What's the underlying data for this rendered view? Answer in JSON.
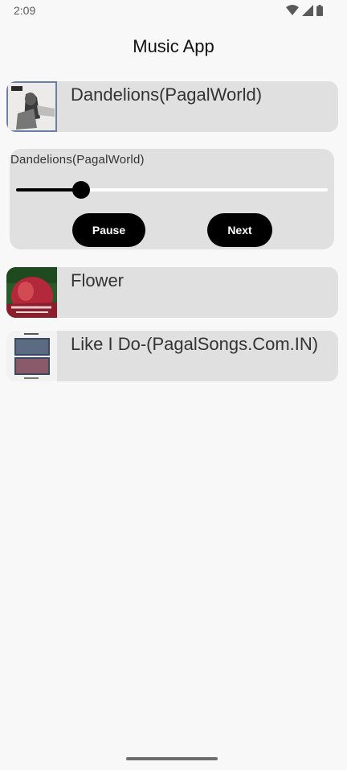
{
  "status_bar": {
    "time": "2:09",
    "icons": [
      "wifi-icon",
      "cell-signal-icon",
      "battery-icon"
    ]
  },
  "app": {
    "title": "Music App"
  },
  "songs": [
    {
      "title": "Dandelions(PagalWorld)",
      "thumbnail": "album-art-dandelions"
    },
    {
      "title": "Flower",
      "thumbnail": "album-art-flower"
    },
    {
      "title": "Like I Do-(PagalSongs.Com.IN)",
      "thumbnail": "album-art-like-i-do"
    }
  ],
  "player": {
    "now_playing": "Dandelions(PagalWorld)",
    "progress": 0.21,
    "pause_label": "Pause",
    "next_label": "Next"
  },
  "colors": {
    "background": "#f8f8f8",
    "card": "#e0e0e0",
    "button": "#000000",
    "button_text": "#ffffff"
  }
}
